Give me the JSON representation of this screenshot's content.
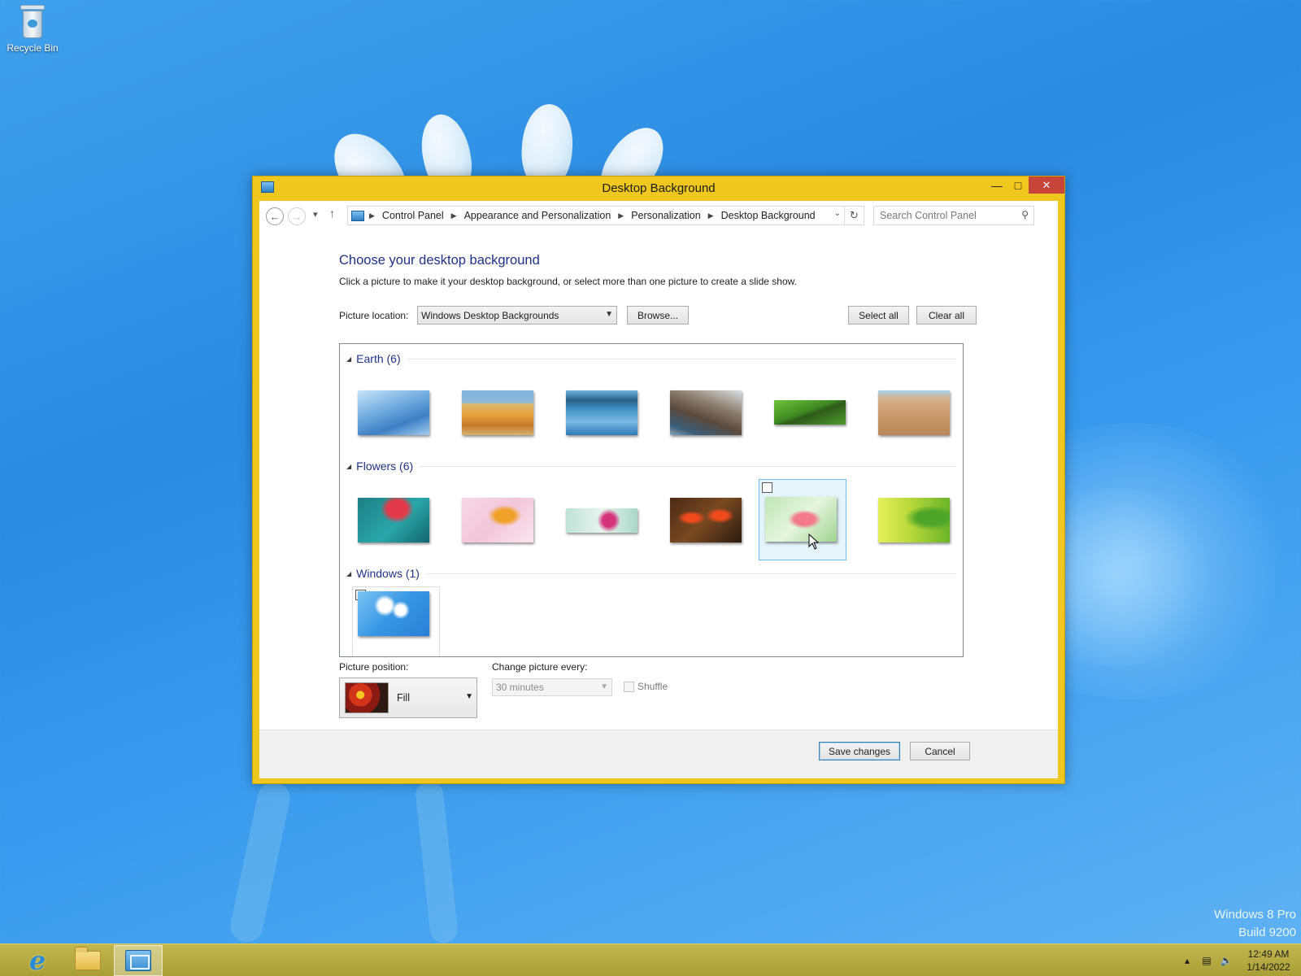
{
  "desktop": {
    "recycle_bin_label": "Recycle Bin",
    "watermark_line1": "Windows 8 Pro",
    "watermark_line2": "Build 9200"
  },
  "window": {
    "title": "Desktop Background",
    "accent_color": "#efc71f",
    "close_color": "#c7443a"
  },
  "address": {
    "breadcrumbs": [
      "Control Panel",
      "Appearance and Personalization",
      "Personalization",
      "Desktop Background"
    ],
    "search_placeholder": "Search Control Panel"
  },
  "main": {
    "heading": "Choose your desktop background",
    "description": "Click a picture to make it your desktop background, or select more than one picture to create a slide show.",
    "picture_location_label": "Picture location:",
    "picture_location_value": "Windows Desktop Backgrounds",
    "browse_label": "Browse...",
    "select_all_label": "Select all",
    "clear_all_label": "Clear all"
  },
  "gallery": {
    "groups": [
      {
        "name": "Earth (6)"
      },
      {
        "name": "Flowers (6)"
      },
      {
        "name": "Windows (1)"
      }
    ],
    "checked_item": "Windows (1) item 1",
    "hovered_item": "Flowers (6) item 5"
  },
  "options": {
    "picture_position_label": "Picture position:",
    "picture_position_value": "Fill",
    "change_every_label": "Change picture every:",
    "change_every_value": "30 minutes",
    "shuffle_label": "Shuffle"
  },
  "footer": {
    "save_label": "Save changes",
    "cancel_label": "Cancel"
  },
  "taskbar": {
    "time": "12:49 AM",
    "date": "1/14/2022"
  }
}
